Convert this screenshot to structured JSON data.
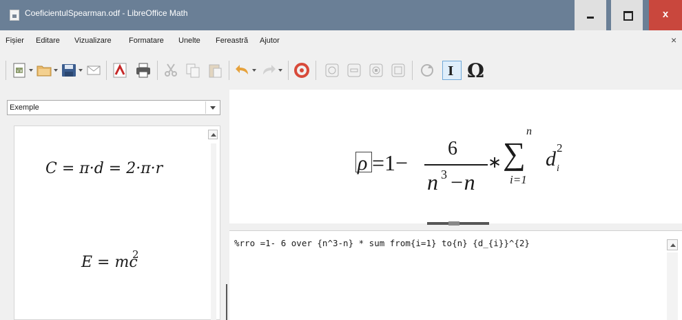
{
  "window": {
    "title": "CoeficientulSpearman.odf - LibreOffice Math",
    "close_glyph": "x"
  },
  "menu": {
    "items": [
      "Fișier",
      "Editare",
      "Vizualizare",
      "Formatare",
      "Unelte",
      "Fereastră",
      "Ajutor"
    ],
    "close_doc_glyph": "×"
  },
  "toolbar": {
    "buttons": [
      {
        "name": "formula-icon"
      },
      {
        "name": "open-folder-icon"
      },
      {
        "name": "save-icon"
      },
      {
        "name": "email-icon"
      },
      {
        "name": "export-pdf-icon"
      },
      {
        "name": "print-icon"
      },
      {
        "name": "cut-icon"
      },
      {
        "name": "copy-icon"
      },
      {
        "name": "paste-icon"
      },
      {
        "name": "undo-icon"
      },
      {
        "name": "redo-icon"
      },
      {
        "name": "zoom-icon"
      },
      {
        "name": "zoom-in-icon"
      },
      {
        "name": "zoom-out-icon"
      },
      {
        "name": "show-all-icon"
      },
      {
        "name": "update-icon"
      },
      {
        "name": "formula-cursor-icon"
      },
      {
        "name": "symbols-icon"
      }
    ],
    "symbols_glyph": "Ω"
  },
  "elements_panel": {
    "selected": "Exemple",
    "examples": {
      "circle": "C = π·d = 2·π·r",
      "energy_base": "E = mc",
      "energy_exp": "2"
    }
  },
  "formula_view": {
    "rho": "ρ",
    "equals_one_minus": "=1−",
    "numerator": "6",
    "denominator_base": "n",
    "denominator_exp": "3",
    "denominator_rest": "−n",
    "times": "∗",
    "sum_symbol": "∑",
    "sum_upper": "n",
    "sum_lower": "i=1",
    "term_base": "d",
    "term_subscript": "i",
    "term_superscript": "2"
  },
  "command": {
    "text": "%rro =1- 6 over {n^3-n} * sum from{i=1} to{n} {d_{i}}^{2}"
  },
  "colors": {
    "titlebar": "#6a7f96",
    "close_button": "#c9473d",
    "window_background": "#f0f0f0"
  }
}
